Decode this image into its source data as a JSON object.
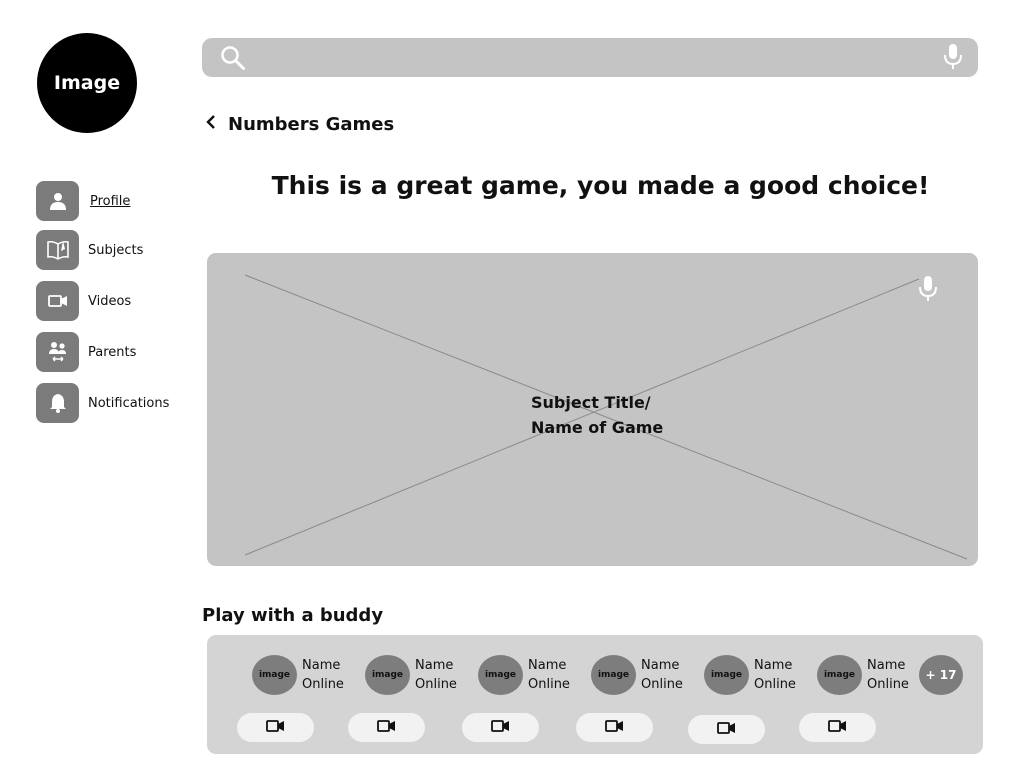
{
  "profile": {
    "image_label": "Image"
  },
  "search": {
    "value": "",
    "placeholder": ""
  },
  "sidebar": {
    "items": [
      {
        "label": "Profile",
        "icon": "person-icon"
      },
      {
        "label": "Subjects",
        "icon": "book-icon"
      },
      {
        "label": "Videos",
        "icon": "video-camera-icon"
      },
      {
        "label": "Parents",
        "icon": "parents-icon"
      },
      {
        "label": "Notifications",
        "icon": "bell-icon"
      }
    ]
  },
  "header": {
    "back_title": "Numbers Games"
  },
  "headline": "This is a great game, you made a good choice!",
  "game": {
    "title": "Subject Title/\nName of Game"
  },
  "buddies": {
    "section_title": "Play with a buddy",
    "items": [
      {
        "image": "image",
        "name": "Name",
        "status": "Online"
      },
      {
        "image": "image",
        "name": "Name",
        "status": "Online"
      },
      {
        "image": "image",
        "name": "Name",
        "status": "Online"
      },
      {
        "image": "image",
        "name": "Name",
        "status": "Online"
      },
      {
        "image": "image",
        "name": "Name",
        "status": "Online"
      },
      {
        "image": "image",
        "name": "Name",
        "status": "Online"
      }
    ],
    "more": "+ 17"
  },
  "colors": {
    "panel": "#c4c4c4",
    "icon_bg": "#7b7b7b",
    "avatar": "#000000"
  }
}
